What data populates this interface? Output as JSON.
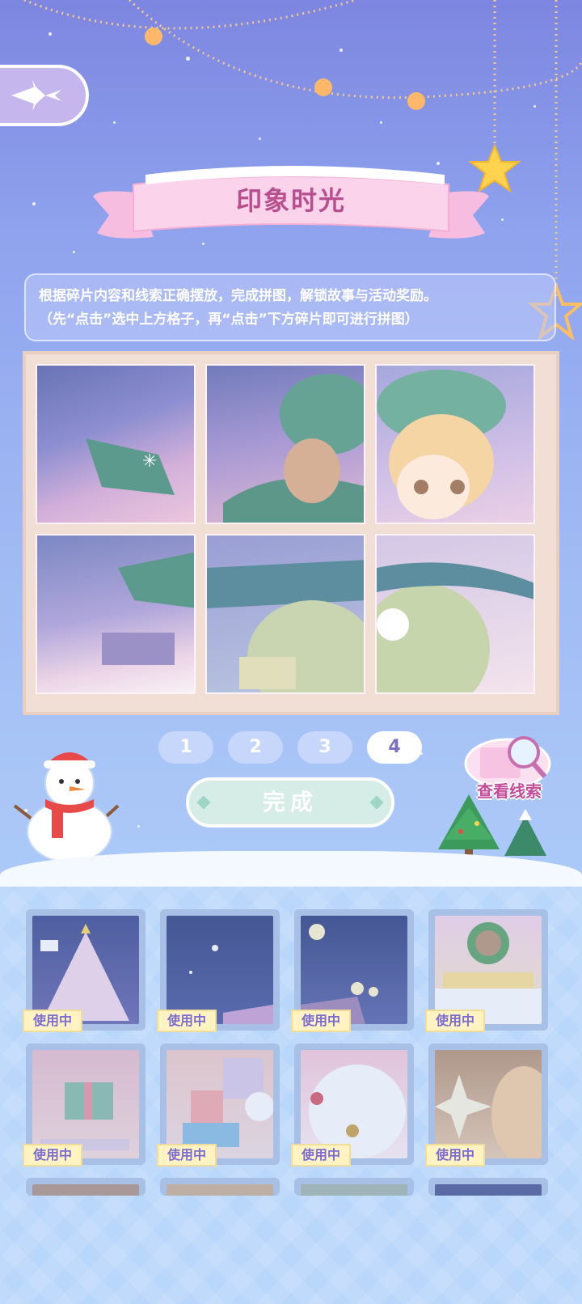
{
  "title": "印象时光",
  "instructions": {
    "line1": "根据碎片内容和线索正确摆放，完成拼图，解锁故事与活动奖励。",
    "line2": "（先“点击”选中上方格子，再“点击”下方碎片即可进行拼图）"
  },
  "pages": [
    "1",
    "2",
    "3",
    "4"
  ],
  "active_page": "4",
  "done_label": "完成",
  "clue_label": "查看线索",
  "in_use_label": "使用中",
  "pieces": [
    {
      "name": "piece-christmas-tree",
      "status": "使用中"
    },
    {
      "name": "piece-night-sky",
      "status": "使用中"
    },
    {
      "name": "piece-street-lights",
      "status": "使用中"
    },
    {
      "name": "piece-wreath-character",
      "status": "使用中"
    },
    {
      "name": "piece-gift-box",
      "status": "使用中"
    },
    {
      "name": "piece-presents",
      "status": "使用中"
    },
    {
      "name": "piece-sheep-character",
      "status": "使用中"
    },
    {
      "name": "piece-sparkle-portrait",
      "status": "使用中"
    }
  ],
  "colors": {
    "title": "#b84f8e",
    "active_page_text": "#7a6fc4",
    "tag_text": "#7b6cd2",
    "clue_text": "#c24e9a"
  },
  "icons": [
    "back-arrow-icon",
    "star-icon",
    "snowman-icon",
    "christmas-tree-icon",
    "magnifier-scroll-icon"
  ]
}
